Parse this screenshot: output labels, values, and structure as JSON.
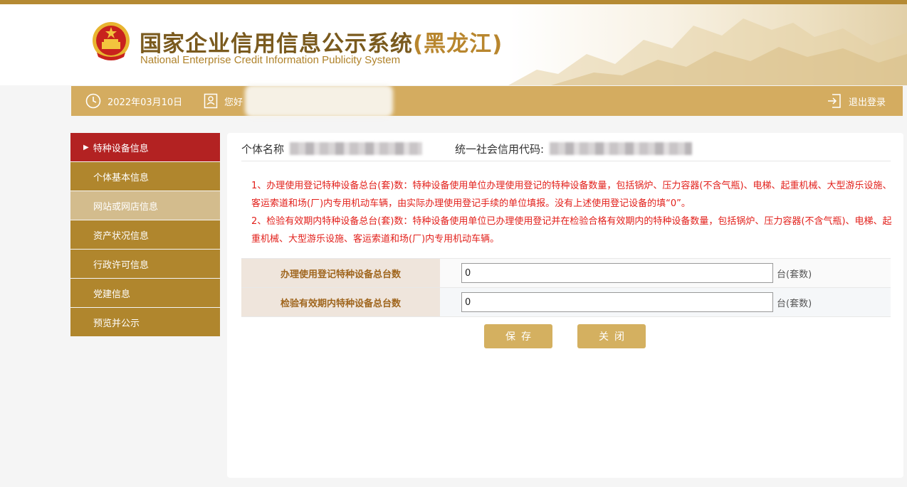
{
  "header": {
    "title_main": "国家企业信用信息公示系统",
    "title_region": "(黑龙江)",
    "title_en": "National Enterprise Credit Information Publicity System"
  },
  "topbar": {
    "date": "2022年03月10日",
    "greeting": "您好",
    "logout_label": "退出登录"
  },
  "sidebar": {
    "items": [
      {
        "label": "特种设备信息",
        "state": "active"
      },
      {
        "label": "个体基本信息",
        "state": "normal"
      },
      {
        "label": "网站或网店信息",
        "state": "hover"
      },
      {
        "label": "资产状况信息",
        "state": "normal"
      },
      {
        "label": "行政许可信息",
        "state": "normal"
      },
      {
        "label": "党建信息",
        "state": "normal"
      },
      {
        "label": "预览并公示",
        "state": "normal"
      }
    ]
  },
  "main": {
    "name_label": "个体名称",
    "code_label": "统一社会信用代码:",
    "notice_1": "1、办理使用登记特种设备总台(套)数：特种设备使用单位办理使用登记的特种设备数量，包括锅炉、压力容器(不含气瓶)、电梯、起重机械、大型游乐设施、客运索道和场(厂)内专用机动车辆，由实际办理使用登记手续的单位填报。没有上述使用登记设备的填“0”。",
    "notice_2": "2、检验有效期内特种设备总台(套)数：特种设备使用单位已办理使用登记并在检验合格有效期内的特种设备数量，包括锅炉、压力容器(不含气瓶)、电梯、起重机械、大型游乐设施、客运索道和场(厂)内专用机动车辆。",
    "form": {
      "rows": [
        {
          "label": "办理使用登记特种设备总台数",
          "value": "0",
          "unit": "台(套数)"
        },
        {
          "label": "检验有效期内特种设备总台数",
          "value": "0",
          "unit": "台(套数)"
        }
      ]
    },
    "save_label": "保存",
    "close_label": "关闭"
  },
  "colors": {
    "gold": "#d4ac60",
    "sidebar_gold": "#b0862d",
    "active_red": "#b32222",
    "notice_red": "#e2201b"
  },
  "icons": [
    "clock-icon",
    "user-card-icon",
    "logout-icon",
    "national-emblem-icon"
  ]
}
